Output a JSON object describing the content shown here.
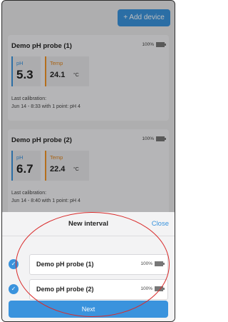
{
  "header": {
    "add_device_label": "+ Add device"
  },
  "devices": [
    {
      "name": "Demo pH probe (1)",
      "battery": "100%",
      "ph_label": "pH",
      "ph_value": "5.3",
      "temp_label": "Temp",
      "temp_value": "24.1",
      "temp_unit": "°C",
      "calib_title": "Last calibration:",
      "calib_detail": "Jun 14 - 8:33 with 1 point: pH 4"
    },
    {
      "name": "Demo pH probe (2)",
      "battery": "100%",
      "ph_label": "pH",
      "ph_value": "6.7",
      "temp_label": "Temp",
      "temp_value": "22.4",
      "temp_unit": "°C",
      "calib_title": "Last calibration:",
      "calib_detail": "Jun 14 - 8:40 with 1 point: pH 4"
    }
  ],
  "sheet": {
    "title": "New interval",
    "close_label": "Close",
    "probes": [
      {
        "name": "Demo pH probe (1)",
        "battery": "100%",
        "selected": true
      },
      {
        "name": "Demo pH probe (2)",
        "battery": "100%",
        "selected": true
      }
    ],
    "next_label": "Next"
  },
  "colors": {
    "accent": "#3a93dd",
    "temp_accent": "#f29526",
    "annotation": "#d92b2b"
  }
}
